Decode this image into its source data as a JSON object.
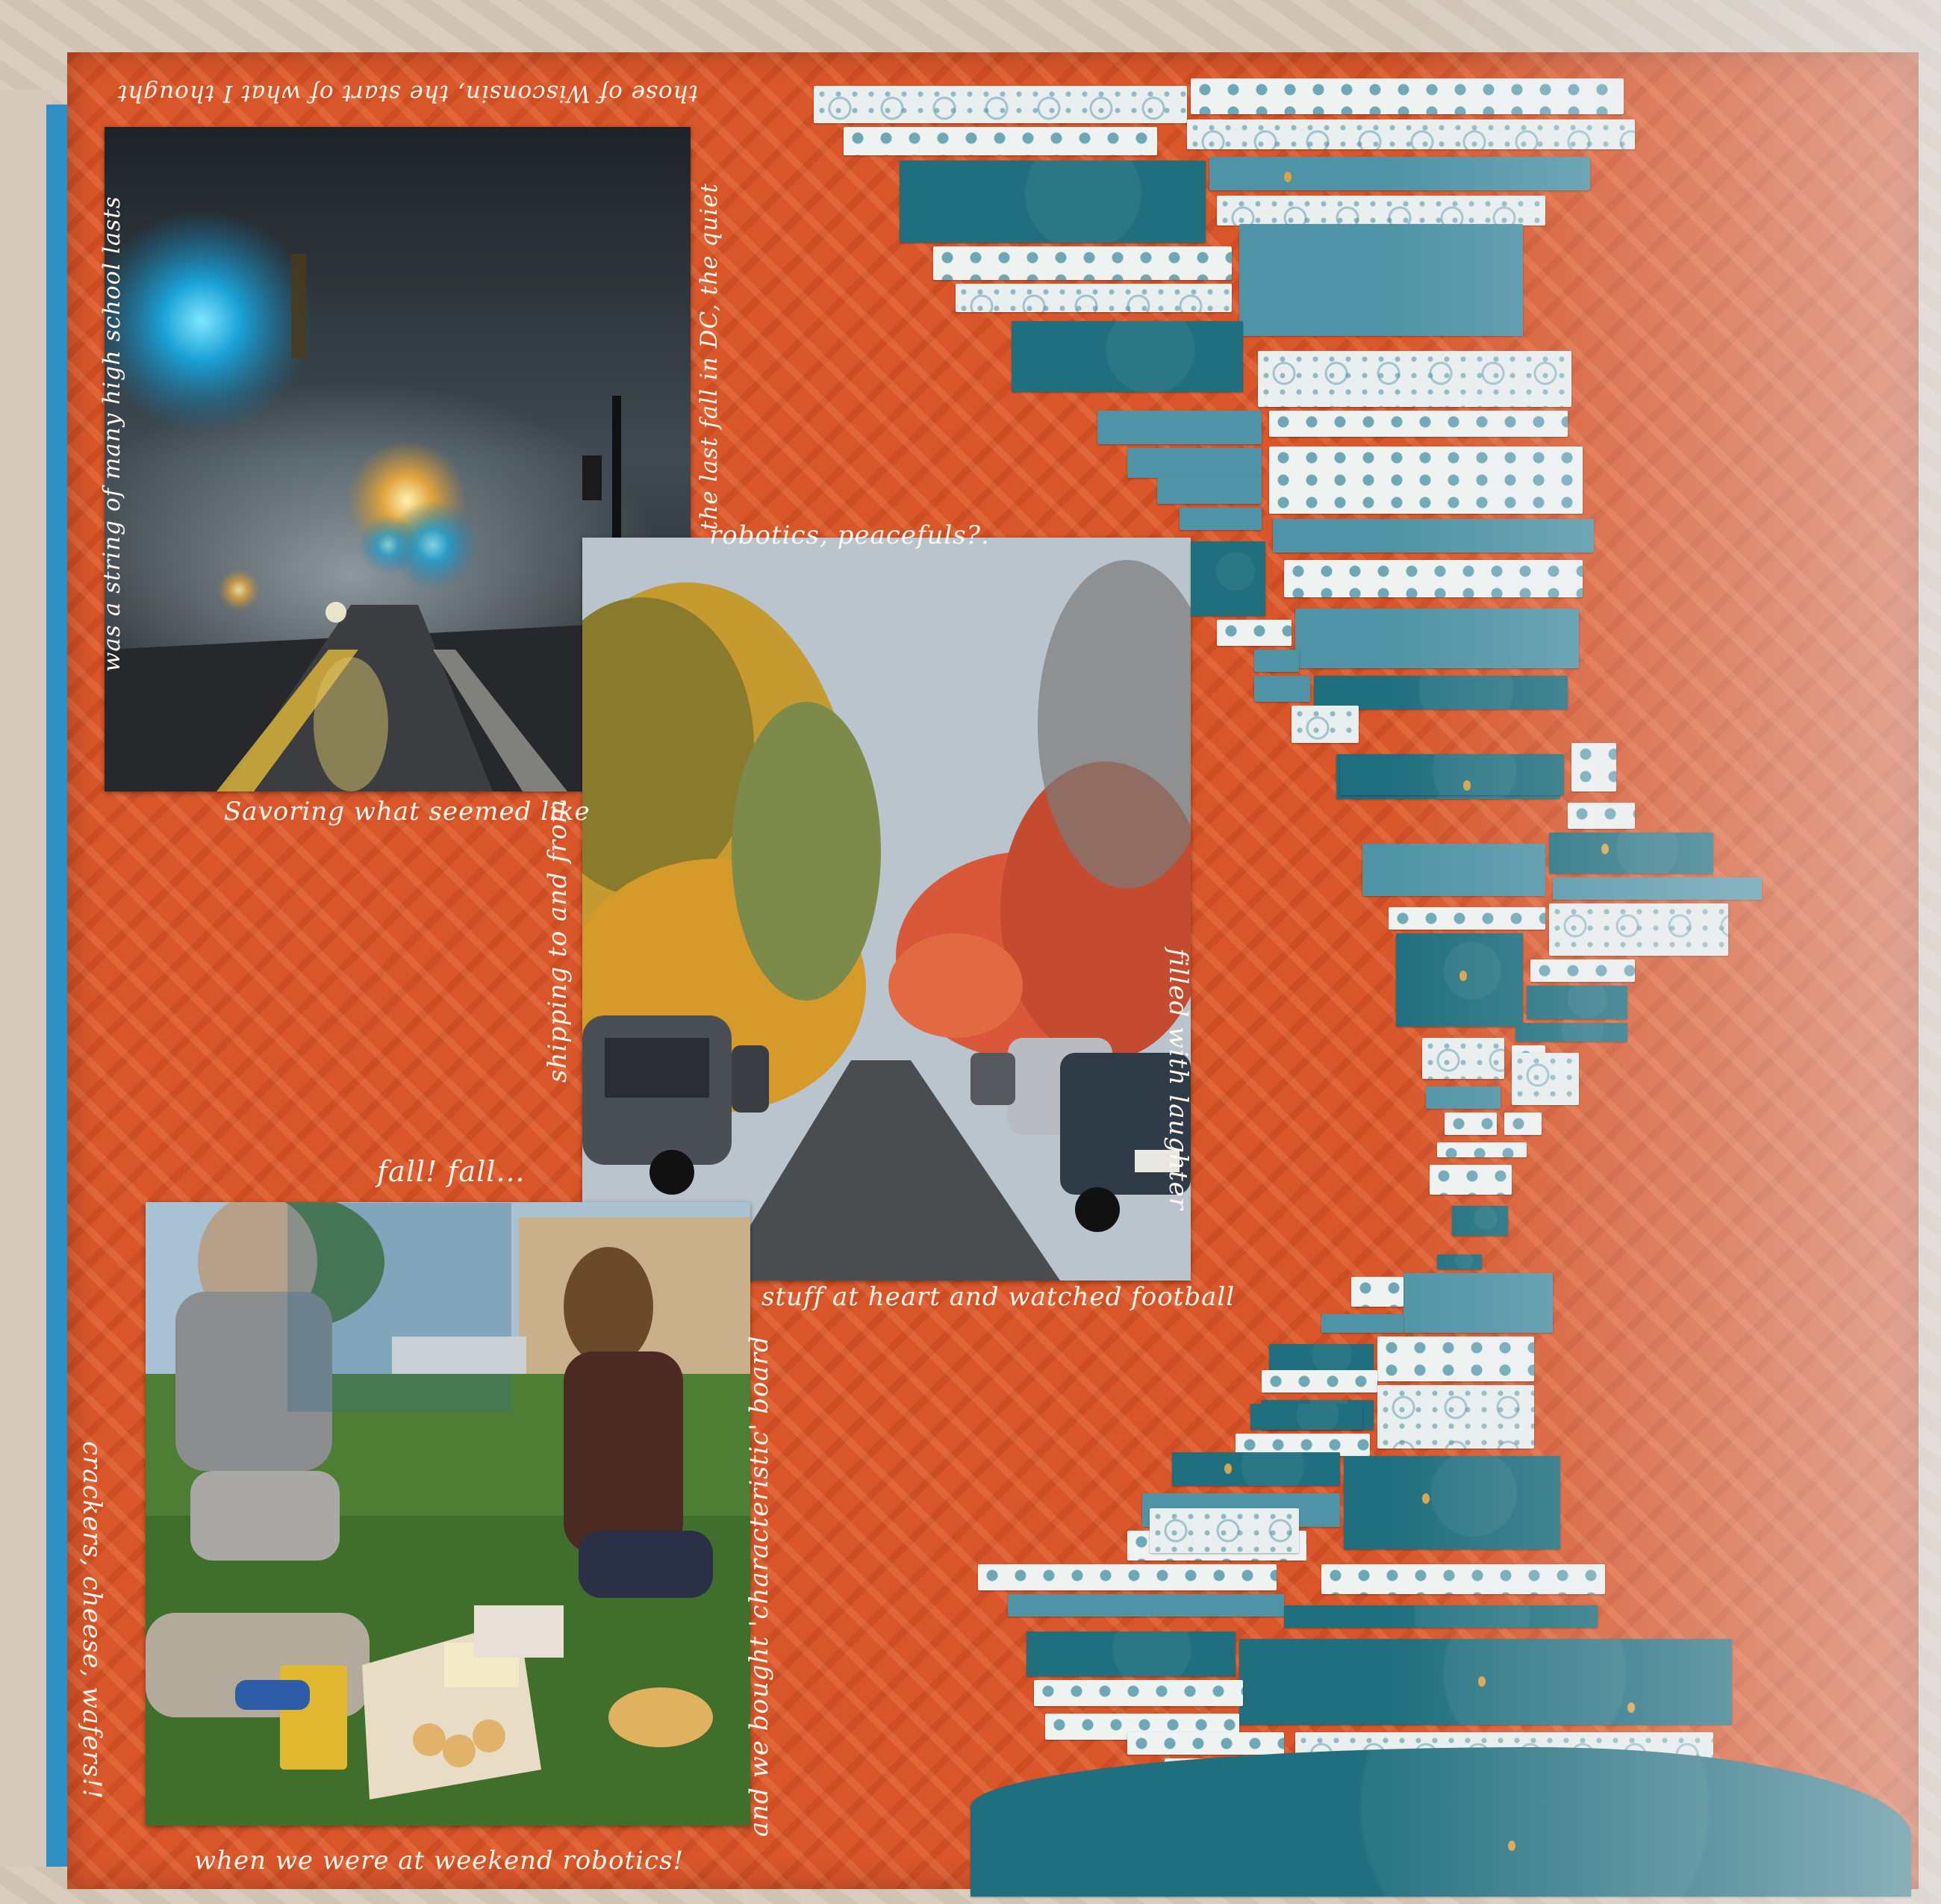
{
  "photos": [
    {
      "id": "foggy-street",
      "subject": "foggy street at night with blue and yellow lights"
    },
    {
      "id": "autumn-street",
      "subject": "tree-lined street with autumn leaves and parked cars"
    },
    {
      "id": "picnic",
      "subject": "people sitting on grass with crackers and cheese"
    }
  ],
  "captions": {
    "top_left_vertical": "was a string of many high school lasts",
    "top_horizontal": "those of Wisconsin, the start of what I thought",
    "top_right_vertical": "the last fall in DC, the quiet",
    "robotics": "robotics, peacefuls?.",
    "savoring": "Savoring what seemed like",
    "shipping": "shipping to and from",
    "filled": "filled with laughter",
    "fall": "fall! fall...",
    "stuff": "stuff at heart and watched football",
    "crackers": "crackers, cheese, wafers!!",
    "characteristic": "and we bought 'characteristic' board",
    "weekend": "when we were at weekend robotics!"
  },
  "colors": {
    "page": "#d8562a",
    "teal": "#1f6f7e",
    "ink": "#fff7ee"
  }
}
